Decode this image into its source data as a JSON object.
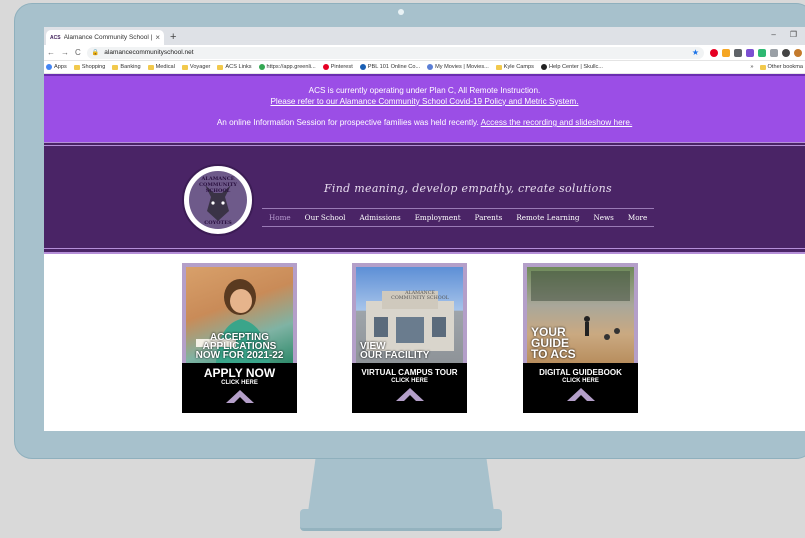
{
  "browser": {
    "tab_title": "Alamance Community School | T",
    "tab_favicon": "ACS",
    "new_tab_label": "+",
    "url": "alamancecommunityschool.net",
    "minimize_label": "–",
    "maximize_label": "❐"
  },
  "bookmarks": [
    {
      "label": "Apps",
      "icon": "apps-grid-icon",
      "color": "#4285f4"
    },
    {
      "label": "Shopping",
      "icon": "folder-icon",
      "color": "#f2c94c"
    },
    {
      "label": "Banking",
      "icon": "folder-icon",
      "color": "#f2c94c"
    },
    {
      "label": "Medical",
      "icon": "folder-icon",
      "color": "#f2c94c"
    },
    {
      "label": "Voyager",
      "icon": "folder-icon",
      "color": "#f2c94c"
    },
    {
      "label": "ACS Links",
      "icon": "folder-icon",
      "color": "#f2c94c"
    },
    {
      "label": "https://app.greenli...",
      "icon": "greenlight-icon",
      "color": "#34a853"
    },
    {
      "label": "Pinterest",
      "icon": "pinterest-icon",
      "color": "#e60023"
    },
    {
      "label": "PBL 101 Online Co...",
      "icon": "course-icon",
      "color": "#1a5fb4"
    },
    {
      "label": "My Movies | Movies...",
      "icon": "movies-icon",
      "color": "#5b7fd6"
    },
    {
      "label": "Kyle Camps",
      "icon": "folder-icon",
      "color": "#f2c94c"
    },
    {
      "label": "Help Center | Skullc...",
      "icon": "skull-icon",
      "color": "#222222"
    }
  ],
  "bookmarks_more": "»",
  "bookmarks_other": "Other bookma",
  "announcement": {
    "line1": "ACS is currently operating under Plan C, All Remote Instruction.",
    "line2_link": "Please refer to our Alamance Community School Covid-19 Policy and Metric System.",
    "line3_text": "An online Information Session for prospective families was held recently. ",
    "line3_link": "Access the recording and slideshow here."
  },
  "header": {
    "logo_top": "ALAMANCE COMMUNITY SCHOOL",
    "logo_bottom": "COYOTES",
    "tagline": "Find meaning, develop empathy, create solutions"
  },
  "menu": [
    "Home",
    "Our School",
    "Admissions",
    "Employment",
    "Parents",
    "Remote Learning",
    "News",
    "More"
  ],
  "cards": [
    {
      "caption_lines": [
        "ACCEPTING",
        "APPLICATIONS",
        "NOW FOR 2021-22"
      ],
      "band_main": "APPLY NOW",
      "band_sub": "CLICK HERE"
    },
    {
      "caption_lines": [
        "VIEW",
        "OUR FACILITY"
      ],
      "band_main": "VIRTUAL CAMPUS TOUR",
      "band_sub": "CLICK HERE",
      "building_sign": "ALAMANCE COMMUNITY SCHOOL"
    },
    {
      "caption_lines": [
        "YOUR",
        "GUIDE",
        "TO ACS"
      ],
      "band_main": "DIGITAL GUIDEBOOK",
      "band_sub": "CLICK HERE"
    }
  ],
  "colors": {
    "announce_bg": "#9b4ee6",
    "header_bg": "#4a2466",
    "card_accent": "#b49fc9",
    "monitor": "#a7c1cc"
  }
}
